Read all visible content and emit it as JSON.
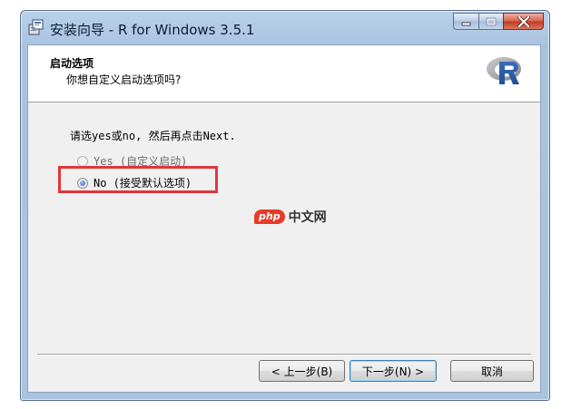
{
  "window": {
    "title": "安装向导 - R for Windows 3.5.1"
  },
  "header": {
    "title": "启动选项",
    "subtitle": "你想自定义启动选项吗?"
  },
  "content": {
    "instruction": "请选yes或no, 然后再点击Next.",
    "options": [
      {
        "label": "Yes (自定义启动)",
        "checked": false,
        "enabled": false
      },
      {
        "label": "No (接受默认选项)",
        "checked": true,
        "enabled": true
      }
    ]
  },
  "watermark": {
    "badge": "php",
    "text": "中文网"
  },
  "buttons": {
    "back": "< 上一步(B)",
    "next": "下一步(N) >",
    "cancel": "取消"
  },
  "colors": {
    "highlight": "#e0363a",
    "close_button": "#c03a22",
    "watermark": "#e63b29"
  },
  "icons": {
    "app": "installer-icon",
    "logo": "r-logo-icon",
    "close": "close-icon",
    "minimize": "minimize-icon",
    "maximize": "maximize-icon"
  }
}
